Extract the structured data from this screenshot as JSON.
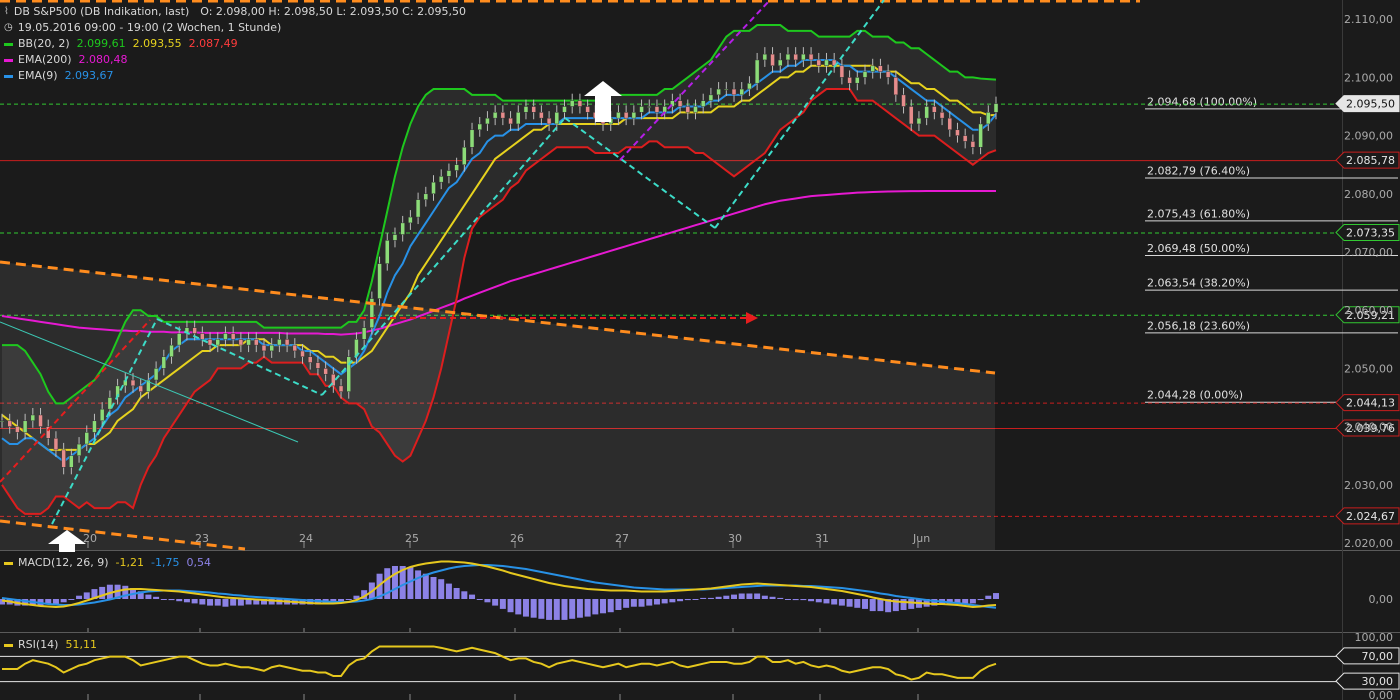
{
  "header": {
    "instrument": "DB S&P500 (DB Indikation, last)",
    "ohlc": "O: 2.098,00  H: 2.098,50  L: 2.093,50  C: 2.095,50",
    "period": "19.05.2016 09:00 - 19:00 (2 Wochen, 1 Stunde)"
  },
  "colors": {
    "bb_upper": "#1ec81e",
    "bb_mid": "#e6d21e",
    "bb_lower": "#dc1e1e",
    "ema200": "#e619d2",
    "ema9": "#2891e6",
    "fib_line": "#d8d8d8",
    "trend_orange": "#ff8c1e",
    "trend_cyan": "#3cdcc8",
    "trend_purple": "#b41ee6",
    "macd_line": "#e6c81e",
    "macd_signal": "#2891e6",
    "macd_hist": "#8c82e6",
    "rsi_line": "#e6c81e"
  },
  "legend": {
    "bb": {
      "label": "BB(20, 2)",
      "v1": "2.099,61",
      "v2": "2.093,55",
      "v3": "2.087,49"
    },
    "ema200": {
      "label": "EMA(200)",
      "v1": "2.080,48"
    },
    "ema9": {
      "label": "EMA(9)",
      "v1": "2.093,67"
    },
    "macd": {
      "label": "MACD(12, 26, 9)",
      "v1": "-1,21",
      "v2": "-1,75",
      "v3": "0,54"
    },
    "rsi": {
      "label": "RSI(14)",
      "v1": "51,11"
    }
  },
  "chart_data": [
    {
      "type": "line",
      "yaxis": {
        "ticks": [
          2020,
          2030,
          2040,
          2050,
          2060,
          2070,
          2080,
          2090,
          2100,
          2110
        ],
        "tick_labels": [
          "2.020,00",
          "2.030,00",
          "2.040,00",
          "2.050,00",
          "2.060,00",
          "2.070,00",
          "2.080,00",
          "2.090,00",
          "2.100,00",
          "2.110,00"
        ]
      },
      "xaxis": {
        "day_labels": [
          "20",
          "23",
          "24",
          "25",
          "26",
          "27",
          "30",
          "31",
          "Jun"
        ]
      },
      "fibonacci": [
        {
          "level": 2094.68,
          "label": "2.094,68 (100.00%)"
        },
        {
          "level": 2082.79,
          "label": "2.082,79 (76.40%)"
        },
        {
          "level": 2075.43,
          "label": "2.075,43 (61.80%)"
        },
        {
          "level": 2069.48,
          "label": "2.069,48 (50.00%)"
        },
        {
          "level": 2063.54,
          "label": "2.063,54 (38.20%)"
        },
        {
          "level": 2056.18,
          "label": "2.056,18 (23.60%)"
        },
        {
          "level": 2044.28,
          "label": "2.044,28 (0.00%)"
        }
      ],
      "price_tags": [
        {
          "value": 2095.5,
          "label": "2.095,50",
          "style": "last"
        },
        {
          "value": 2085.78,
          "label": "2.085,78",
          "style": "red"
        },
        {
          "value": 2073.35,
          "label": "2.073,35",
          "style": "green"
        },
        {
          "value": 2059.21,
          "label": "2.059,21",
          "style": "green"
        },
        {
          "value": 2044.13,
          "label": "2.044,13",
          "style": "red"
        },
        {
          "value": 2039.76,
          "label": "2.039,76",
          "style": "red"
        },
        {
          "value": 2024.67,
          "label": "2.024,67",
          "style": "red"
        }
      ],
      "close": [
        2041,
        2040,
        2039,
        2041,
        2042,
        2040,
        2038,
        2036,
        2033,
        2035,
        2037,
        2039,
        2041,
        2043,
        2045,
        2047,
        2048,
        2047,
        2046,
        2048,
        2050,
        2052,
        2054,
        2056,
        2057,
        2056,
        2055,
        2054,
        2055,
        2056,
        2055,
        2054,
        2055,
        2054,
        2053,
        2054,
        2055,
        2054,
        2053,
        2052,
        2051,
        2050,
        2049,
        2047,
        2046,
        2052,
        2055,
        2057,
        2062,
        2068,
        2072,
        2073,
        2075,
        2076,
        2079,
        2080,
        2082,
        2083,
        2084,
        2085,
        2088,
        2091,
        2092,
        2093,
        2094,
        2093,
        2092,
        2094,
        2095,
        2094,
        2093,
        2092,
        2094,
        2095,
        2096,
        2095,
        2094,
        2093,
        2092,
        2093,
        2094,
        2093,
        2094,
        2095,
        2095,
        2094,
        2095,
        2096,
        2095,
        2094,
        2095,
        2096,
        2097,
        2098,
        2098,
        2097,
        2098,
        2099,
        2103,
        2104,
        2102,
        2103,
        2104,
        2103,
        2104,
        2103,
        2102,
        2103,
        2102,
        2100,
        2099,
        2100,
        2101,
        2102,
        2101,
        2100,
        2097,
        2095,
        2092,
        2093,
        2095,
        2094,
        2093,
        2091,
        2090,
        2089,
        2088,
        2092,
        2094,
        2095.5
      ],
      "ema9": [
        2038,
        2037,
        2037,
        2038,
        2038,
        2037,
        2036,
        2035,
        2034,
        2035,
        2036,
        2037,
        2038,
        2040,
        2042,
        2043,
        2045,
        2046,
        2047,
        2048,
        2049,
        2051,
        2053,
        2054,
        2055,
        2055,
        2055,
        2055,
        2055,
        2055,
        2055,
        2055,
        2055,
        2055,
        2054,
        2054,
        2054,
        2054,
        2054,
        2053,
        2053,
        2052,
        2051,
        2050,
        2049,
        2050,
        2051,
        2053,
        2056,
        2059,
        2063,
        2066,
        2068,
        2071,
        2073,
        2075,
        2077,
        2079,
        2081,
        2082,
        2084,
        2086,
        2087,
        2089,
        2090,
        2090,
        2091,
        2091,
        2092,
        2092,
        2092,
        2092,
        2092,
        2093,
        2093,
        2093,
        2093,
        2093,
        2093,
        2093,
        2093,
        2093,
        2093,
        2093,
        2094,
        2094,
        2094,
        2094,
        2095,
        2095,
        2095,
        2095,
        2096,
        2096,
        2097,
        2097,
        2097,
        2098,
        2099,
        2100,
        2101,
        2101,
        2102,
        2102,
        2103,
        2103,
        2103,
        2103,
        2103,
        2102,
        2102,
        2101,
        2101,
        2101,
        2101,
        2101,
        2100,
        2099,
        2098,
        2097,
        2096,
        2096,
        2095,
        2094,
        2093,
        2092,
        2091,
        2091,
        2092,
        2093.67
      ],
      "bb_mid": [
        2042,
        2041,
        2040,
        2039,
        2038,
        2037,
        2036,
        2036,
        2036,
        2036,
        2036,
        2037,
        2037,
        2038,
        2039,
        2041,
        2042,
        2043,
        2045,
        2046,
        2047,
        2048,
        2049,
        2050,
        2051,
        2052,
        2053,
        2053,
        2054,
        2054,
        2054,
        2054,
        2055,
        2055,
        2055,
        2054,
        2054,
        2054,
        2054,
        2054,
        2053,
        2053,
        2052,
        2052,
        2051,
        2051,
        2051,
        2052,
        2053,
        2055,
        2057,
        2059,
        2061,
        2063,
        2066,
        2068,
        2070,
        2072,
        2074,
        2076,
        2078,
        2080,
        2082,
        2084,
        2086,
        2087,
        2088,
        2089,
        2090,
        2091,
        2091,
        2092,
        2092,
        2092,
        2092,
        2092,
        2092,
        2092,
        2092,
        2092,
        2092,
        2093,
        2093,
        2093,
        2093,
        2093,
        2093,
        2093,
        2094,
        2094,
        2094,
        2094,
        2094,
        2095,
        2095,
        2095,
        2096,
        2096,
        2097,
        2098,
        2099,
        2100,
        2100,
        2101,
        2101,
        2102,
        2102,
        2102,
        2102,
        2102,
        2102,
        2102,
        2102,
        2102,
        2101,
        2101,
        2101,
        2100,
        2099,
        2099,
        2098,
        2098,
        2097,
        2096,
        2096,
        2095,
        2094,
        2094,
        2093.5,
        2093.55
      ],
      "bb_upper": [
        2054,
        2054,
        2054,
        2053,
        2051,
        2049,
        2046,
        2044,
        2044,
        2045,
        2046,
        2047,
        2048,
        2050,
        2052,
        2055,
        2058,
        2060,
        2060,
        2059,
        2059,
        2058,
        2058,
        2058,
        2058,
        2058,
        2058,
        2058,
        2058,
        2058,
        2058,
        2058,
        2058,
        2058,
        2057,
        2057,
        2057,
        2057,
        2057,
        2057,
        2057,
        2057,
        2057,
        2057,
        2057,
        2058,
        2058,
        2060,
        2065,
        2071,
        2077,
        2083,
        2088,
        2092,
        2095,
        2097,
        2098,
        2098,
        2098,
        2098,
        2098,
        2097,
        2097,
        2097,
        2097,
        2096,
        2096,
        2096,
        2096,
        2096,
        2096,
        2096,
        2096,
        2096,
        2096,
        2096,
        2096,
        2096,
        2097,
        2097,
        2097,
        2097,
        2097,
        2097,
        2097,
        2097,
        2098,
        2098,
        2099,
        2100,
        2101,
        2102,
        2103,
        2105,
        2107,
        2108,
        2108,
        2108,
        2109,
        2109,
        2109,
        2109,
        2108,
        2108,
        2108,
        2108,
        2107,
        2107,
        2107,
        2107,
        2107,
        2108,
        2108,
        2107,
        2107,
        2107,
        2106,
        2106,
        2105,
        2105,
        2104,
        2103,
        2102,
        2101,
        2101,
        2100,
        2100,
        2099.8,
        2099.7,
        2099.61
      ],
      "bb_lower": [
        2030,
        2028,
        2026,
        2025,
        2025,
        2025,
        2026,
        2028,
        2028,
        2027,
        2026,
        2027,
        2026,
        2026,
        2026,
        2027,
        2027,
        2026,
        2030,
        2033,
        2035,
        2038,
        2040,
        2042,
        2044,
        2046,
        2047,
        2048,
        2050,
        2050,
        2050,
        2050,
        2051,
        2051,
        2052,
        2051,
        2051,
        2051,
        2051,
        2051,
        2049,
        2049,
        2047,
        2047,
        2045,
        2044,
        2044,
        2043,
        2040,
        2039,
        2037,
        2035,
        2034,
        2035,
        2038,
        2041,
        2045,
        2050,
        2056,
        2062,
        2069,
        2074,
        2076,
        2077,
        2078,
        2079,
        2081,
        2082,
        2084,
        2085,
        2086,
        2087,
        2088,
        2088,
        2088,
        2088,
        2088,
        2087,
        2087,
        2087,
        2087,
        2088,
        2088,
        2088,
        2089,
        2089,
        2088,
        2088,
        2088,
        2088,
        2087,
        2087,
        2086,
        2085,
        2084,
        2083,
        2084,
        2085,
        2086,
        2087,
        2089,
        2091,
        2092,
        2093,
        2094,
        2096,
        2097,
        2098,
        2098,
        2098,
        2098,
        2096,
        2096,
        2096,
        2095,
        2094,
        2093,
        2092,
        2091,
        2090,
        2090,
        2090,
        2089,
        2088,
        2087,
        2086,
        2085,
        2086,
        2087,
        2087.49
      ],
      "ema200": [
        2059,
        2058.8,
        2058.6,
        2058.4,
        2058.2,
        2058,
        2057.8,
        2057.6,
        2057.4,
        2057.2,
        2057,
        2056.9,
        2056.8,
        2056.7,
        2056.6,
        2056.5,
        2056.5,
        2056.4,
        2056.4,
        2056.3,
        2056.3,
        2056.3,
        2056.2,
        2056.2,
        2056.2,
        2056.2,
        2056.1,
        2056.1,
        2056.1,
        2056.1,
        2056.1,
        2056.1,
        2056.1,
        2056.1,
        2056.1,
        2056.1,
        2056.1,
        2056,
        2056,
        2056,
        2056,
        2056,
        2055.9,
        2055.9,
        2055.8,
        2055.9,
        2056,
        2056.2,
        2056.5,
        2056.8,
        2057.2,
        2057.6,
        2058,
        2058.4,
        2058.9,
        2059.4,
        2059.9,
        2060.4,
        2060.9,
        2061.4,
        2062,
        2062.5,
        2063,
        2063.5,
        2064,
        2064.5,
        2065,
        2065.4,
        2065.8,
        2066.2,
        2066.6,
        2067,
        2067.4,
        2067.8,
        2068.2,
        2068.6,
        2069,
        2069.4,
        2069.8,
        2070.2,
        2070.6,
        2071,
        2071.4,
        2071.8,
        2072.2,
        2072.6,
        2073,
        2073.4,
        2073.8,
        2074.2,
        2074.6,
        2075,
        2075.4,
        2075.8,
        2076.2,
        2076.6,
        2077,
        2077.4,
        2077.8,
        2078.2,
        2078.5,
        2078.8,
        2079,
        2079.2,
        2079.4,
        2079.6,
        2079.7,
        2079.8,
        2079.9,
        2080,
        2080.1,
        2080.2,
        2080.25,
        2080.3,
        2080.35,
        2080.4,
        2080.42,
        2080.44,
        2080.46,
        2080.47,
        2080.48,
        2080.48,
        2080.48,
        2080.48,
        2080.48,
        2080.48,
        2080.48,
        2080.48,
        2080.48,
        2080.48
      ],
      "macd_line": [
        -0.3,
        -0.5,
        -0.8,
        -1.0,
        -1.2,
        -1.4,
        -1.5,
        -1.6,
        -1.5,
        -1.2,
        -0.8,
        -0.3,
        0.2,
        0.7,
        1.2,
        1.6,
        1.9,
        2.0,
        2.0,
        1.9,
        1.8,
        1.7,
        1.6,
        1.5,
        1.3,
        1.1,
        0.9,
        0.7,
        0.5,
        0.3,
        0.2,
        0.1,
        0,
        -0.1,
        -0.2,
        -0.3,
        -0.4,
        -0.5,
        -0.6,
        -0.7,
        -0.8,
        -0.9,
        -0.9,
        -0.9,
        -0.8,
        -0.6,
        -0.2,
        0.5,
        1.5,
        2.8,
        4.0,
        5.0,
        5.8,
        6.4,
        6.8,
        7.1,
        7.3,
        7.5,
        7.5,
        7.4,
        7.3,
        7.1,
        6.8,
        6.5,
        6.1,
        5.7,
        5.2,
        4.8,
        4.4,
        4.0,
        3.6,
        3.2,
        2.9,
        2.6,
        2.4,
        2.2,
        2.0,
        1.9,
        1.8,
        1.7,
        1.7,
        1.7,
        1.6,
        1.5,
        1.5,
        1.5,
        1.5,
        1.6,
        1.7,
        1.8,
        1.9,
        2.0,
        2.1,
        2.3,
        2.5,
        2.7,
        2.9,
        3.0,
        3.1,
        3.0,
        2.9,
        2.8,
        2.7,
        2.6,
        2.5,
        2.4,
        2.2,
        2.0,
        1.8,
        1.6,
        1.3,
        1.0,
        0.7,
        0.3,
        0,
        -0.3,
        -0.5,
        -0.6,
        -0.7,
        -0.8,
        -0.9,
        -1.0,
        -1.0,
        -1.1,
        -1.2,
        -1.4,
        -1.6,
        -1.5,
        -1.3,
        -1.21
      ],
      "macd_signal": [
        0.2,
        0.0,
        -0.2,
        -0.4,
        -0.6,
        -0.8,
        -1.0,
        -1.1,
        -1.2,
        -1.2,
        -1.1,
        -0.9,
        -0.7,
        -0.4,
        -0.1,
        0.3,
        0.7,
        1.0,
        1.3,
        1.5,
        1.6,
        1.7,
        1.7,
        1.7,
        1.6,
        1.5,
        1.4,
        1.3,
        1.1,
        1.0,
        0.8,
        0.7,
        0.5,
        0.4,
        0.3,
        0.2,
        0.1,
        0,
        -0.1,
        -0.2,
        -0.3,
        -0.4,
        -0.5,
        -0.6,
        -0.6,
        -0.6,
        -0.5,
        -0.3,
        0,
        0.5,
        1.2,
        2.0,
        2.8,
        3.5,
        4.2,
        4.8,
        5.3,
        5.7,
        6.1,
        6.4,
        6.6,
        6.7,
        6.8,
        6.8,
        6.7,
        6.6,
        6.4,
        6.2,
        6.0,
        5.7,
        5.4,
        5.1,
        4.8,
        4.5,
        4.2,
        3.9,
        3.6,
        3.3,
        3.1,
        2.9,
        2.7,
        2.5,
        2.3,
        2.2,
        2.1,
        2.0,
        1.9,
        1.9,
        1.9,
        1.9,
        1.9,
        1.9,
        2.0,
        2.1,
        2.2,
        2.3,
        2.4,
        2.5,
        2.6,
        2.7,
        2.7,
        2.7,
        2.7,
        2.7,
        2.6,
        2.6,
        2.5,
        2.4,
        2.3,
        2.2,
        2.0,
        1.8,
        1.6,
        1.4,
        1.1,
        0.9,
        0.6,
        0.4,
        0.2,
        0,
        -0.2,
        -0.4,
        -0.5,
        -0.7,
        -0.8,
        -1.0,
        -1.2,
        -1.4,
        -1.6,
        -1.75
      ]
    }
  ]
}
